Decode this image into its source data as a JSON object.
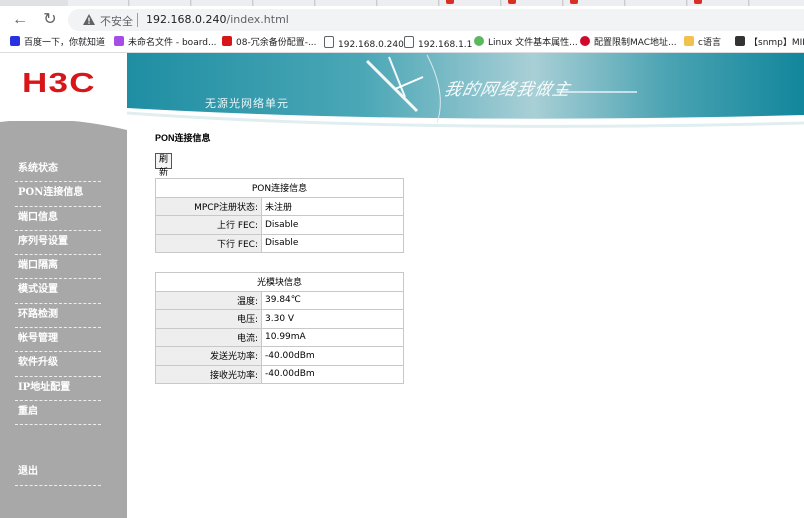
{
  "browser": {
    "back_glyph": "←",
    "reload_glyph": "↻",
    "insecure_label": "不安全",
    "url_host": "192.168.0.240",
    "url_path": "/index.html"
  },
  "bookmarks": [
    {
      "label": "百度一下，你就知道",
      "icon_color": "#2932e1"
    },
    {
      "label": "未命名文件 - board...",
      "icon_color": "#a54de5"
    },
    {
      "label": "08-冗余备份配置-...",
      "icon_color": "#d8161a"
    },
    {
      "label": "192.168.0.240",
      "icon_color": "#5f6368"
    },
    {
      "label": "192.168.1.1",
      "icon_color": "#5f6368"
    },
    {
      "label": "Linux 文件基本属性...",
      "icon_color": "#5cb85c"
    },
    {
      "label": "配置限制MAC地址...",
      "icon_color": "#cf0a2c"
    },
    {
      "label": "c语言",
      "icon_color": "#f2c14e"
    },
    {
      "label": "【snmp】MIB",
      "icon_color": "#333333"
    }
  ],
  "logo": {
    "text": "H3C",
    "color": "#d8161a"
  },
  "banner": {
    "title": "无源光网络单元",
    "slogan": "我的网络我做主"
  },
  "menu": [
    "系统状态",
    "PON连接信息",
    "端口信息",
    "序列号设置",
    "端口隔离",
    "模式设置",
    "环路检测",
    "帐号管理",
    "软件升级",
    "IP地址配置",
    "重启"
  ],
  "logout_label": "退出",
  "page": {
    "title": "PON连接信息",
    "refresh_label": "刷新"
  },
  "pon_table": {
    "header": "PON连接信息",
    "rows": [
      {
        "label": "MPCP注册状态:",
        "value": "未注册"
      },
      {
        "label": "上行 FEC:",
        "value": "Disable"
      },
      {
        "label": "下行 FEC:",
        "value": "Disable"
      }
    ]
  },
  "optic_table": {
    "header": "光模块信息",
    "rows": [
      {
        "label": "温度:",
        "value": "39.84℃"
      },
      {
        "label": "电压:",
        "value": "3.30 V"
      },
      {
        "label": "电流:",
        "value": "10.99mA"
      },
      {
        "label": "发送光功率:",
        "value": "-40.00dBm"
      },
      {
        "label": "接收光功率:",
        "value": "-40.00dBm"
      }
    ]
  },
  "colors": {
    "brand_red": "#d8161a",
    "sidebar_gray": "#a8a8a8",
    "banner_teal": "#2d8fa0"
  }
}
